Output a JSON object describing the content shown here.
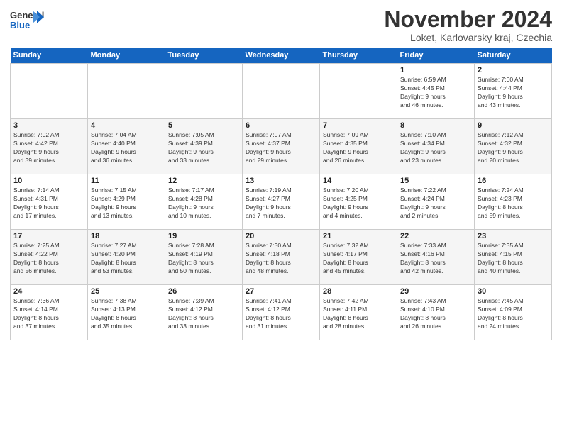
{
  "header": {
    "logo_general": "General",
    "logo_blue": "Blue",
    "month_title": "November 2024",
    "subtitle": "Loket, Karlovarsky kraj, Czechia"
  },
  "weekdays": [
    "Sunday",
    "Monday",
    "Tuesday",
    "Wednesday",
    "Thursday",
    "Friday",
    "Saturday"
  ],
  "weeks": [
    [
      {
        "day": "",
        "info": ""
      },
      {
        "day": "",
        "info": ""
      },
      {
        "day": "",
        "info": ""
      },
      {
        "day": "",
        "info": ""
      },
      {
        "day": "",
        "info": ""
      },
      {
        "day": "1",
        "info": "Sunrise: 6:59 AM\nSunset: 4:45 PM\nDaylight: 9 hours\nand 46 minutes."
      },
      {
        "day": "2",
        "info": "Sunrise: 7:00 AM\nSunset: 4:44 PM\nDaylight: 9 hours\nand 43 minutes."
      }
    ],
    [
      {
        "day": "3",
        "info": "Sunrise: 7:02 AM\nSunset: 4:42 PM\nDaylight: 9 hours\nand 39 minutes."
      },
      {
        "day": "4",
        "info": "Sunrise: 7:04 AM\nSunset: 4:40 PM\nDaylight: 9 hours\nand 36 minutes."
      },
      {
        "day": "5",
        "info": "Sunrise: 7:05 AM\nSunset: 4:39 PM\nDaylight: 9 hours\nand 33 minutes."
      },
      {
        "day": "6",
        "info": "Sunrise: 7:07 AM\nSunset: 4:37 PM\nDaylight: 9 hours\nand 29 minutes."
      },
      {
        "day": "7",
        "info": "Sunrise: 7:09 AM\nSunset: 4:35 PM\nDaylight: 9 hours\nand 26 minutes."
      },
      {
        "day": "8",
        "info": "Sunrise: 7:10 AM\nSunset: 4:34 PM\nDaylight: 9 hours\nand 23 minutes."
      },
      {
        "day": "9",
        "info": "Sunrise: 7:12 AM\nSunset: 4:32 PM\nDaylight: 9 hours\nand 20 minutes."
      }
    ],
    [
      {
        "day": "10",
        "info": "Sunrise: 7:14 AM\nSunset: 4:31 PM\nDaylight: 9 hours\nand 17 minutes."
      },
      {
        "day": "11",
        "info": "Sunrise: 7:15 AM\nSunset: 4:29 PM\nDaylight: 9 hours\nand 13 minutes."
      },
      {
        "day": "12",
        "info": "Sunrise: 7:17 AM\nSunset: 4:28 PM\nDaylight: 9 hours\nand 10 minutes."
      },
      {
        "day": "13",
        "info": "Sunrise: 7:19 AM\nSunset: 4:27 PM\nDaylight: 9 hours\nand 7 minutes."
      },
      {
        "day": "14",
        "info": "Sunrise: 7:20 AM\nSunset: 4:25 PM\nDaylight: 9 hours\nand 4 minutes."
      },
      {
        "day": "15",
        "info": "Sunrise: 7:22 AM\nSunset: 4:24 PM\nDaylight: 9 hours\nand 2 minutes."
      },
      {
        "day": "16",
        "info": "Sunrise: 7:24 AM\nSunset: 4:23 PM\nDaylight: 8 hours\nand 59 minutes."
      }
    ],
    [
      {
        "day": "17",
        "info": "Sunrise: 7:25 AM\nSunset: 4:22 PM\nDaylight: 8 hours\nand 56 minutes."
      },
      {
        "day": "18",
        "info": "Sunrise: 7:27 AM\nSunset: 4:20 PM\nDaylight: 8 hours\nand 53 minutes."
      },
      {
        "day": "19",
        "info": "Sunrise: 7:28 AM\nSunset: 4:19 PM\nDaylight: 8 hours\nand 50 minutes."
      },
      {
        "day": "20",
        "info": "Sunrise: 7:30 AM\nSunset: 4:18 PM\nDaylight: 8 hours\nand 48 minutes."
      },
      {
        "day": "21",
        "info": "Sunrise: 7:32 AM\nSunset: 4:17 PM\nDaylight: 8 hours\nand 45 minutes."
      },
      {
        "day": "22",
        "info": "Sunrise: 7:33 AM\nSunset: 4:16 PM\nDaylight: 8 hours\nand 42 minutes."
      },
      {
        "day": "23",
        "info": "Sunrise: 7:35 AM\nSunset: 4:15 PM\nDaylight: 8 hours\nand 40 minutes."
      }
    ],
    [
      {
        "day": "24",
        "info": "Sunrise: 7:36 AM\nSunset: 4:14 PM\nDaylight: 8 hours\nand 37 minutes."
      },
      {
        "day": "25",
        "info": "Sunrise: 7:38 AM\nSunset: 4:13 PM\nDaylight: 8 hours\nand 35 minutes."
      },
      {
        "day": "26",
        "info": "Sunrise: 7:39 AM\nSunset: 4:12 PM\nDaylight: 8 hours\nand 33 minutes."
      },
      {
        "day": "27",
        "info": "Sunrise: 7:41 AM\nSunset: 4:12 PM\nDaylight: 8 hours\nand 31 minutes."
      },
      {
        "day": "28",
        "info": "Sunrise: 7:42 AM\nSunset: 4:11 PM\nDaylight: 8 hours\nand 28 minutes."
      },
      {
        "day": "29",
        "info": "Sunrise: 7:43 AM\nSunset: 4:10 PM\nDaylight: 8 hours\nand 26 minutes."
      },
      {
        "day": "30",
        "info": "Sunrise: 7:45 AM\nSunset: 4:09 PM\nDaylight: 8 hours\nand 24 minutes."
      }
    ]
  ]
}
